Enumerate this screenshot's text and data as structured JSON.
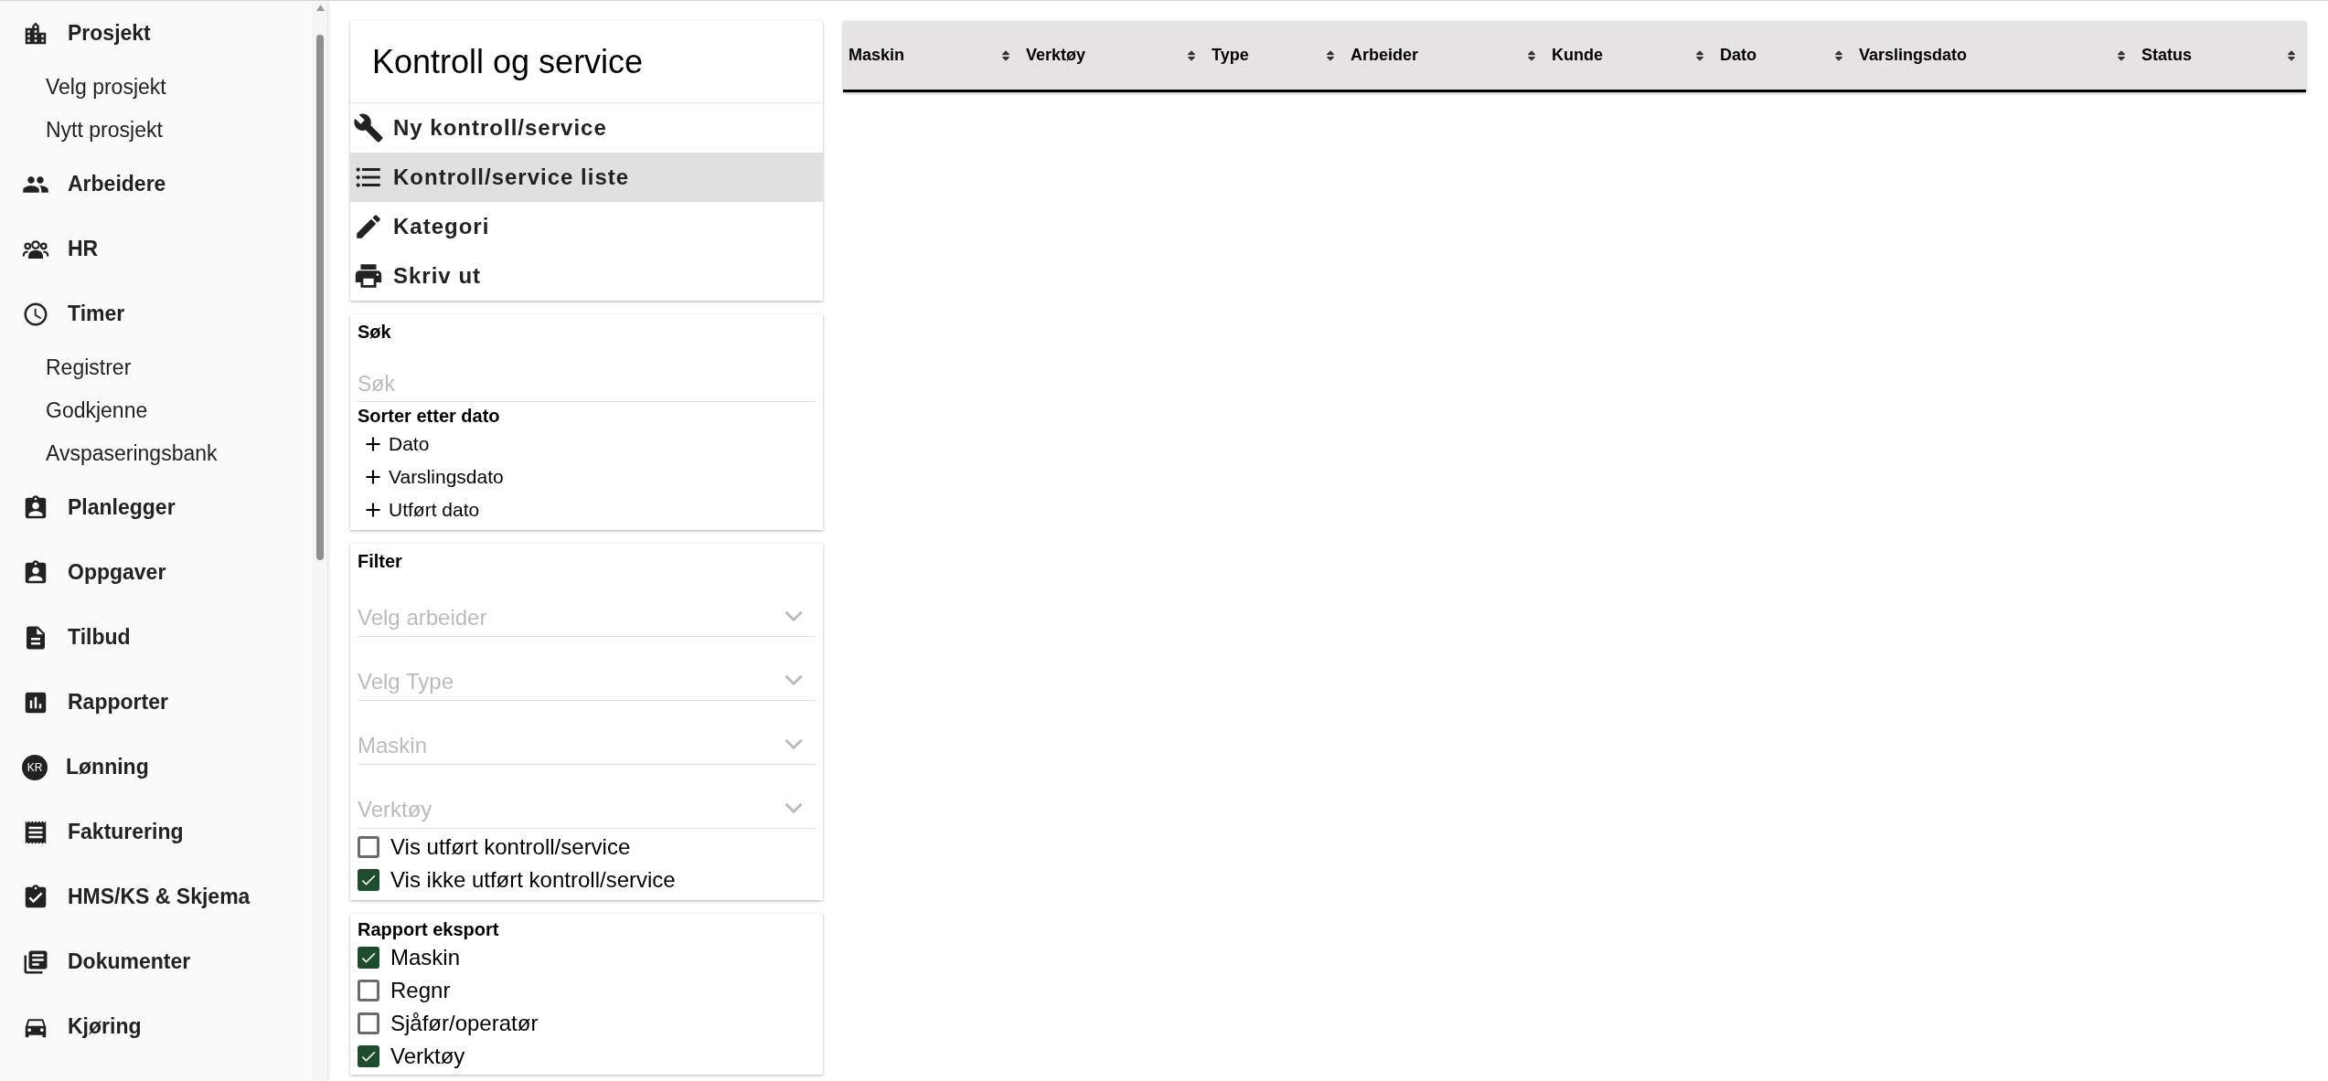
{
  "sidebar": {
    "items": [
      {
        "label": "Prosjekt",
        "children": [
          {
            "label": "Velg prosjekt"
          },
          {
            "label": "Nytt prosjekt"
          }
        ]
      },
      {
        "label": "Arbeidere"
      },
      {
        "label": "HR"
      },
      {
        "label": "Timer",
        "children": [
          {
            "label": "Registrer"
          },
          {
            "label": "Godkjenne"
          },
          {
            "label": "Avspaseringsbank"
          }
        ]
      },
      {
        "label": "Planlegger"
      },
      {
        "label": "Oppgaver"
      },
      {
        "label": "Tilbud"
      },
      {
        "label": "Rapporter"
      },
      {
        "label": "Lønning",
        "icon_text": "KR"
      },
      {
        "label": "Fakturering"
      },
      {
        "label": "HMS/KS & Skjema"
      },
      {
        "label": "Dokumenter"
      },
      {
        "label": "Kjøring"
      }
    ]
  },
  "panel": {
    "title": "Kontroll og service",
    "menu": [
      {
        "label": "Ny kontroll/service",
        "selected": false
      },
      {
        "label": "Kontroll/service liste",
        "selected": true
      },
      {
        "label": "Kategori",
        "selected": false
      },
      {
        "label": "Skriv ut",
        "selected": false
      }
    ]
  },
  "search": {
    "heading": "Søk",
    "placeholder": "Søk",
    "sort_heading": "Sorter etter dato",
    "sort_options": [
      "Dato",
      "Varslingsdato",
      "Utført dato"
    ]
  },
  "filter": {
    "heading": "Filter",
    "selects": [
      {
        "placeholder": "Velg arbeider"
      },
      {
        "placeholder": "Velg Type"
      },
      {
        "placeholder": "Maskin"
      },
      {
        "placeholder": "Verktøy"
      }
    ],
    "checkboxes": [
      {
        "label": "Vis utført kontroll/service",
        "checked": false
      },
      {
        "label": "Vis ikke utført kontroll/service",
        "checked": true
      }
    ]
  },
  "report_export": {
    "heading": "Rapport eksport",
    "checkboxes": [
      {
        "label": "Maskin",
        "checked": true
      },
      {
        "label": "Regnr",
        "checked": false
      },
      {
        "label": "Sjåfør/operatør",
        "checked": false
      },
      {
        "label": "Verktøy",
        "checked": true
      }
    ]
  },
  "table": {
    "columns": [
      "Maskin",
      "Verktøy",
      "Type",
      "Arbeider",
      "Kunde",
      "Dato",
      "Varslingsdato",
      "Status"
    ]
  }
}
